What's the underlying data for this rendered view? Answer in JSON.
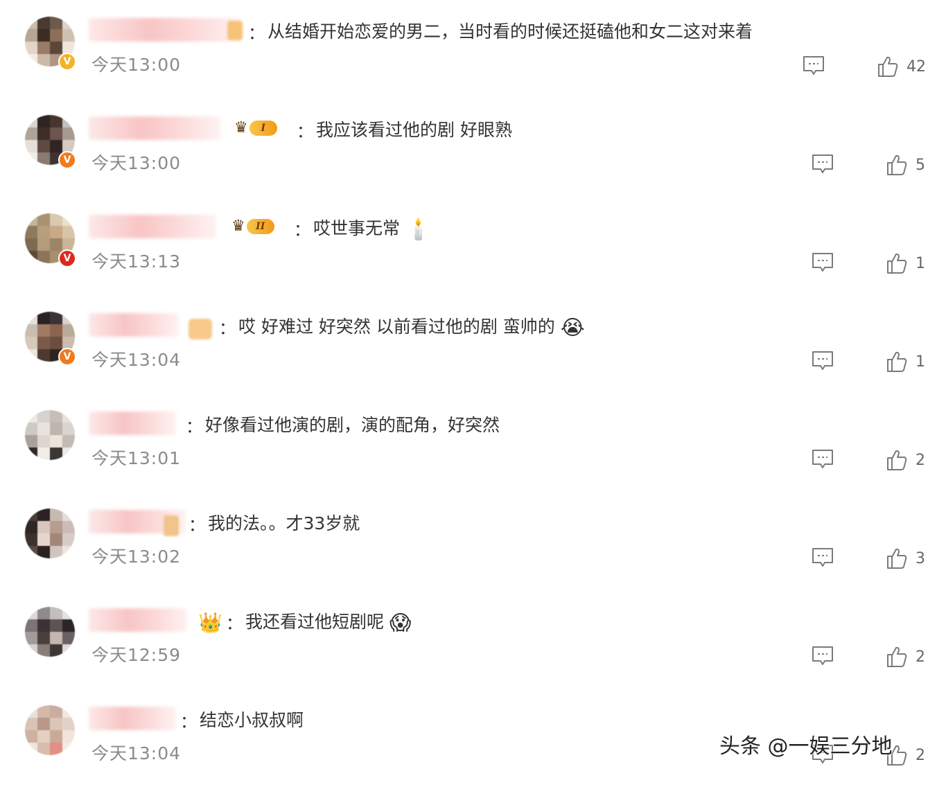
{
  "comments": [
    {
      "text": "从结婚开始恋爱的男二，当时看的时候还挺磕他和女二这对来着",
      "time": "今天13:00",
      "likes": "42",
      "badge_color": "#f3b326",
      "medal": "",
      "emoji": ""
    },
    {
      "text": "我应该看过他的剧 好眼熟",
      "time": "今天13:00",
      "likes": "5",
      "badge_color": "#f07a1c",
      "medal": "I",
      "emoji": ""
    },
    {
      "text": "哎世事无常",
      "time": "今天13:13",
      "likes": "1",
      "badge_color": "#e0291b",
      "medal": "II",
      "emoji": "candle-icon"
    },
    {
      "text": "哎 好难过 好突然 以前看过他的剧 蛮帅的",
      "time": "今天13:04",
      "likes": "1",
      "badge_color": "#f07a1c",
      "medal": "",
      "emoji": "crying-face-icon"
    },
    {
      "text": "好像看过他演的剧，演的配角，好突然",
      "time": "今天13:01",
      "likes": "2",
      "badge_color": "",
      "medal": "",
      "emoji": ""
    },
    {
      "text": "我的法。。才33岁就",
      "time": "今天13:02",
      "likes": "3",
      "badge_color": "",
      "medal": "",
      "emoji": ""
    },
    {
      "text": "我还看过他短剧呢",
      "time": "今天12:59",
      "likes": "2",
      "badge_color": "",
      "medal": "",
      "emoji": "screaming-face-icon"
    },
    {
      "text": "结恋小叔叔啊",
      "time": "今天13:04",
      "likes": "2",
      "badge_color": "",
      "medal": "",
      "emoji": ""
    }
  ],
  "colon": "：",
  "watermark": "头条 @一娱三分地",
  "badge_letter": "V"
}
